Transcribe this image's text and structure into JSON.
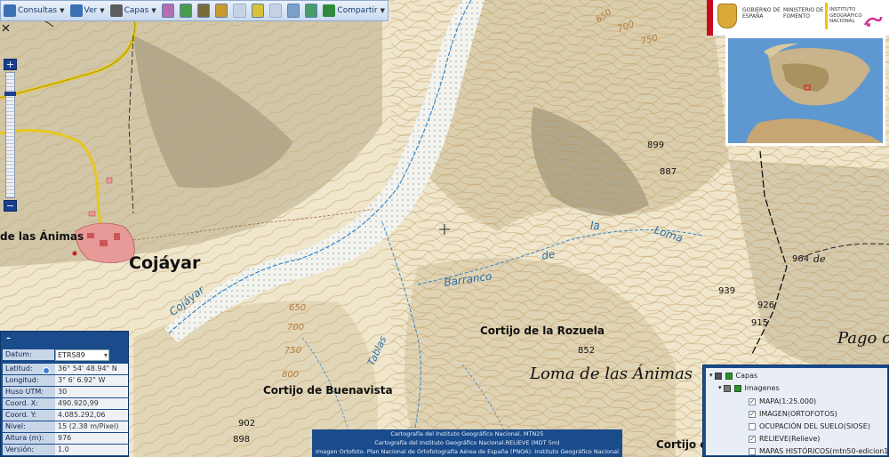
{
  "toolbar": {
    "items": [
      {
        "label": "Consultas",
        "icon": "query-icon"
      },
      {
        "label": "Ver",
        "icon": "view-icon"
      },
      {
        "label": "Capas",
        "icon": "layers-icon"
      },
      {
        "label": "Compartir",
        "icon": "share-icon"
      }
    ]
  },
  "header": {
    "gov": "GOBIERNO DE ESPAÑA",
    "ministry": "MINISTERIO DE FOMENTO",
    "institute": "INSTITUTO GEOGRÁFICO NACIONAL"
  },
  "map_labels": {
    "town": "Cojáyar",
    "de_las_animas": "de las Ánimas",
    "cojayar_stream": "Cojáyar",
    "barranco": "Barranco",
    "de": "de",
    "la": "la",
    "loma": "Loma",
    "tablas": "Tablas",
    "cortijo_rozuela": "Cortijo de la Rozuela",
    "loma_animas": "Loma de las Ánimas",
    "cortijo_buenavista": "Cortijo de Buenavista",
    "cortijo_right": "Cortijo d",
    "pago": "Pago c",
    "de_right": "de"
  },
  "elevations": [
    "650",
    "700",
    "750",
    "899",
    "887",
    "964",
    "939",
    "926",
    "915",
    "852",
    "650",
    "700",
    "750",
    "800",
    "902",
    "898"
  ],
  "coords": {
    "datum_label": "Datum:",
    "datum_value": "ETRS89",
    "rows": [
      {
        "label": "Latitud:",
        "value": "36° 54' 48.94\" N"
      },
      {
        "label": "Longitud:",
        "value": "3° 6' 6.92\" W"
      },
      {
        "label": "Huso UTM:",
        "value": "30"
      },
      {
        "label": "Coord. X:",
        "value": "490.920,99"
      },
      {
        "label": "Coord. Y:",
        "value": "4.085.292,06"
      },
      {
        "label": "Nivel:",
        "value": "15 (2.38 m/Pixel)"
      },
      {
        "label": "Altura (m):",
        "value": "976"
      },
      {
        "label": "Versión:",
        "value": "1.0"
      }
    ]
  },
  "layers": {
    "root": "Capas",
    "group": "Imagenes",
    "items": [
      {
        "label": "MAPA(1:25.000)",
        "checked": true
      },
      {
        "label": "IMAGEN(ORTOFOTOS)",
        "checked": true
      },
      {
        "label": "OCUPACIÓN DEL SUELO(SIOSE)",
        "checked": false
      },
      {
        "label": "RELIEVE(Relieve)",
        "checked": true
      },
      {
        "label": "MAPAS HISTÓRICOS(mtn50-edicion1)",
        "checked": false
      }
    ]
  },
  "attribution": [
    "Cartografía del Instituto Geográfico Nacional. MTN25",
    "Cartografía del Instituto Geográfico Nacional.RELIEVE (MDT 5m)",
    "Imagen Ortofoto. Plan Nacional de Ortofotografía Aérea de España (PNOA). Instituto Geográfico Nacional"
  ]
}
